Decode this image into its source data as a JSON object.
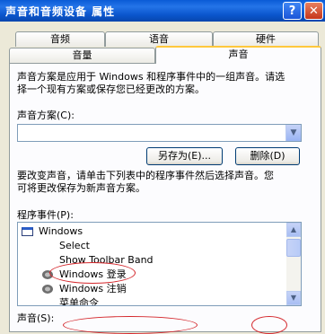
{
  "window": {
    "title": "声音和音频设备 属性",
    "help_glyph": "?",
    "close_glyph": "✕"
  },
  "tabs_row1": [
    {
      "label": "音频"
    },
    {
      "label": "语音"
    },
    {
      "label": "硬件"
    }
  ],
  "tabs_row2": [
    {
      "label": "音量"
    },
    {
      "label": "声音",
      "active": true
    }
  ],
  "sound_tab": {
    "description_line1": "声音方案是应用于 Windows 和程序事件中的一组声音。请选",
    "description_line2": "择一个现有方案或保存您已经更改的方案。",
    "scheme_label": "声音方案(C):",
    "scheme_value": "",
    "save_as_button": "另存为(E)...",
    "delete_button": "删除(D)",
    "change_line1": "要改变声音，请单击下列表中的程序事件然后选择声音。您",
    "change_line2": "可将更改保存为新声音方案。",
    "events_label": "程序事件(P):",
    "events": [
      {
        "label": "Windows",
        "icon": "window-icon"
      },
      {
        "label": "Select",
        "icon": ""
      },
      {
        "label": "Show Toolbar Band",
        "icon": ""
      },
      {
        "label": "Windows 登录",
        "icon": "speaker-icon"
      },
      {
        "label": "Windows 注销",
        "icon": "speaker-icon"
      },
      {
        "label": "菜单命令",
        "icon": ""
      }
    ],
    "sounds_label": "声音(S):"
  },
  "colors": {
    "titlebar": "#0A55CC",
    "dialog_bg": "#ECE9D8",
    "annotation_red": "#D4262B",
    "tab_highlight": "#FFC83C"
  }
}
